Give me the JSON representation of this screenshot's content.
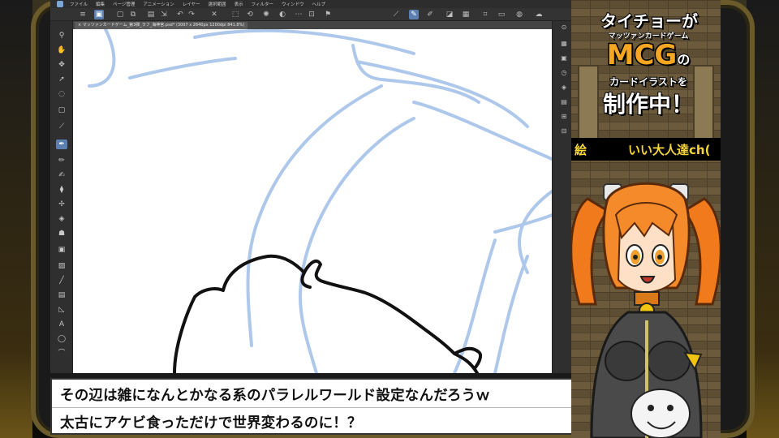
{
  "app": {
    "menu": [
      "ファイル",
      "編集",
      "ページ管理",
      "アニメーション",
      "レイヤー",
      "選択範囲",
      "表示",
      "フィルター",
      "ウィンドウ",
      "ヘルプ"
    ],
    "tab_title": "× マッツァンカードゲーム_第3弾_ラフ_海神宮.psd* (3007 x 2640px 1200dpi 841.8%)"
  },
  "caption": {
    "line1": "その辺は雑になんとかなる系のパラレルワールド設定なんだろうｗ",
    "line2": "太古にアケビ食っただけで世界変わるのに！？"
  },
  "overlay": {
    "title_top": "タイチョーが",
    "title_sub": "マッツァンカードゲーム",
    "title_mcg": "MCG",
    "title_no": "の",
    "title_card": "カードイラストを",
    "title_bottom": "制作中！",
    "ticker_left": "絵",
    "ticker_right": "いい大人達ch("
  },
  "colors": {
    "sketch_blue": "#aec8ec",
    "line_black": "#111111",
    "accent_orange": "#f5a623",
    "ui_dark": "#2f2f2f"
  }
}
